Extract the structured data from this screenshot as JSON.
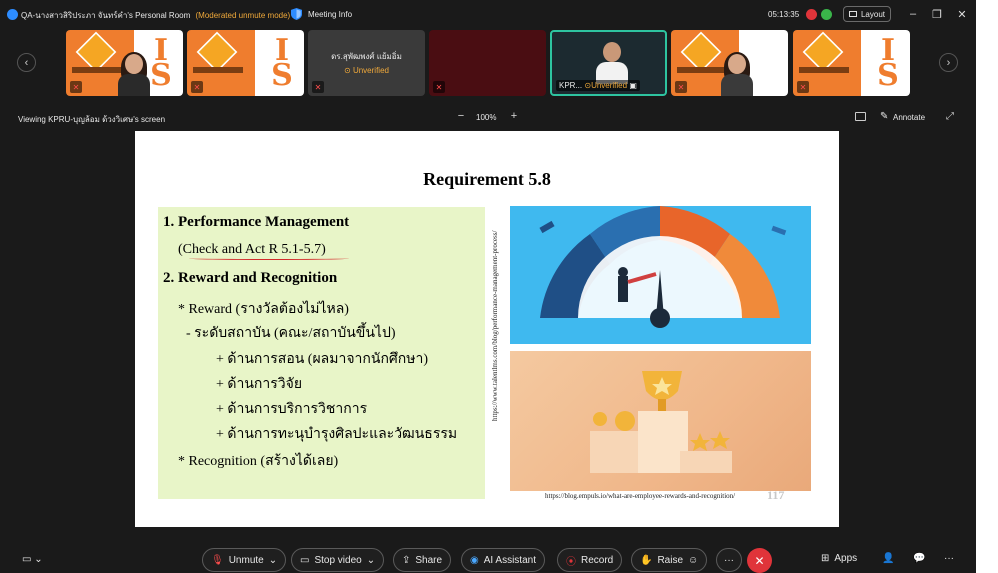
{
  "window": {
    "title": "QA-นางสาวสิริประภา จันทร์คำ's Personal Room",
    "mode": "(Moderated unmute mode)",
    "meeting_info": "Meeting Info",
    "clock": "05:13:35",
    "layout_label": "Layout"
  },
  "participants": [
    {
      "type": "orange"
    },
    {
      "type": "orange"
    },
    {
      "type": "gray",
      "name": "ดร.สุพัฒพงศ์ แย้มอิ่ม",
      "status": "Unverified"
    },
    {
      "type": "red"
    },
    {
      "type": "active",
      "name": "KPR...",
      "status": "Unverified"
    },
    {
      "type": "orange"
    },
    {
      "type": "orange"
    }
  ],
  "viewbar": {
    "viewing": "Viewing KPRU-บุญล้อม ด้วงวิเศษ's screen",
    "zoom": "100%",
    "annotate": "Annotate"
  },
  "slide": {
    "title": "Requirement 5.8",
    "lines": [
      "1. Performance Management",
      "(Check and Act R 5.1-5.7)",
      "2. Reward and Recognition",
      "* Reward (รางวัลต้องไม่ไหล)",
      "- ระดับสถาบัน (คณะ/สถาบันขึ้นไป)",
      "+ ด้านการสอน (ผลมาจากนักศึกษา)",
      "+ ด้านการวิจัย",
      "+ ด้านการบริการวิชาการ",
      "+ ด้านการทะนุบำรุงศิลปะและวัฒนธรรม",
      "* Recognition (สร้างได้เลย)"
    ],
    "url_vertical": "https://www.talentlms.com/blog/performance-management-process/",
    "url_bottom": "https://blog.empuls.io/what-are-employee-rewards-and-recognition/",
    "page_number": "117"
  },
  "toolbar": {
    "unmute": "Unmute",
    "stop_video": "Stop video",
    "share": "Share",
    "ai_assistant": "AI Assistant",
    "record": "Record",
    "raise": "Raise",
    "more": "···",
    "apps": "Apps"
  },
  "colors": {
    "accent_orange": "#ef7d2e",
    "unverified": "#f0a93a",
    "end_call": "#e0343a",
    "active_border": "#2ec4a0"
  }
}
